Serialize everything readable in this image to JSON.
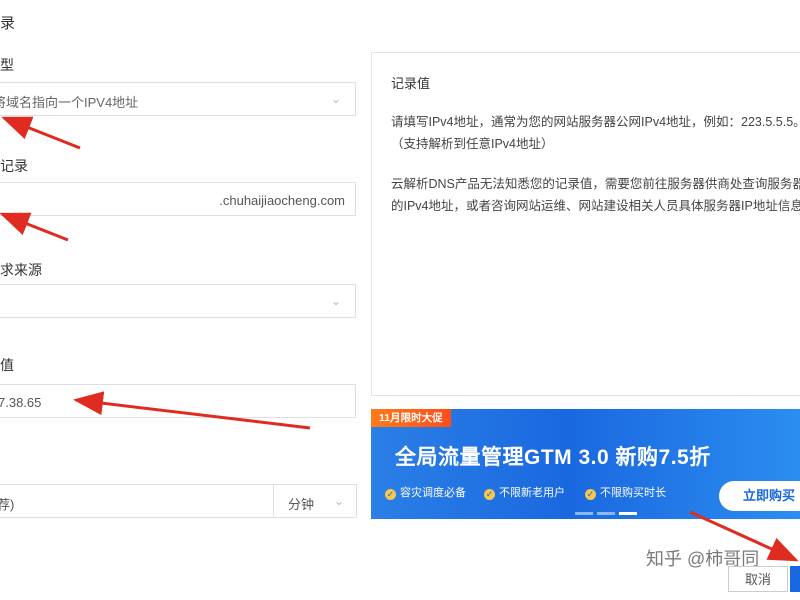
{
  "page": {
    "title": "录"
  },
  "fields": {
    "type": {
      "label": "型",
      "value": "将域名指向一个IPV4地址"
    },
    "host": {
      "label": "记录",
      "domain_suffix": ".chuhaijiaocheng.com"
    },
    "line": {
      "label": "求来源",
      "value": ""
    },
    "value": {
      "label": "值",
      "value": "7.38.65"
    },
    "ttl": {
      "value": "荐)",
      "unit": "分钟"
    }
  },
  "help": {
    "title": "记录值",
    "para1": "请填写IPv4地址，通常为您的网站服务器公网IPv4地址，例如：223.5.5.5。（支持解析到任意IPv4地址）",
    "para2": "云解析DNS产品无法知悉您的记录值，需要您前往服务器供商处查询服务器的IPv4地址，或者咨询网站运维、网站建设相关人员具体服务器IP地址信息"
  },
  "banner": {
    "tag": "11月限时大促",
    "headline": "全局流量管理GTM 3.0 新购7.5折",
    "features": [
      "容灾调度必备",
      "不限新老用户",
      "不限购买时长"
    ],
    "cta": "立即购买"
  },
  "footer": {
    "cancel": "取消",
    "watermark": "知乎 @柿哥同"
  },
  "colors": {
    "accent": "#1a68e0",
    "arrow": "#e02b20",
    "border": "#dcdfe6"
  }
}
